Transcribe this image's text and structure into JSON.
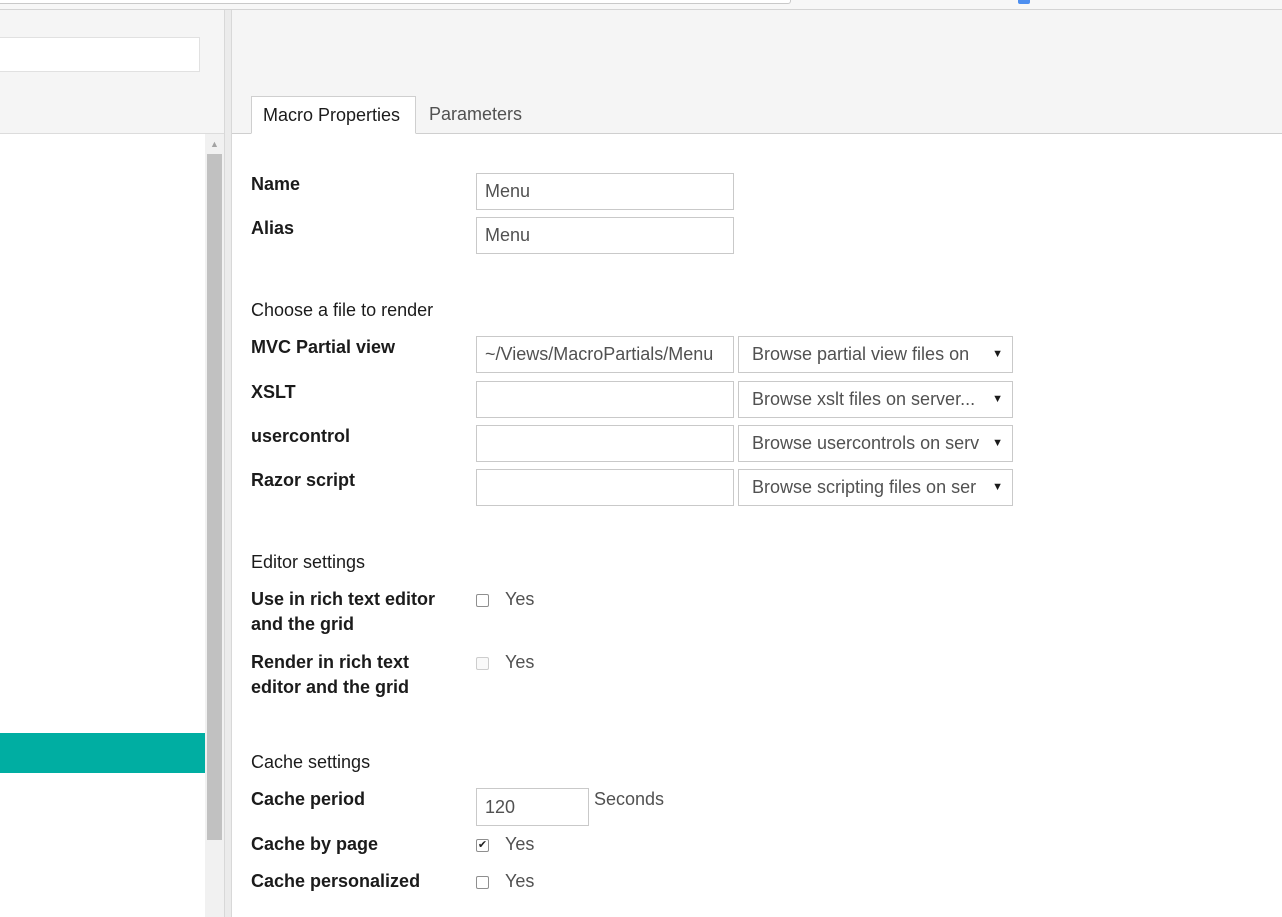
{
  "tabs": [
    {
      "label": "Macro Properties",
      "active": true
    },
    {
      "label": "Parameters",
      "active": false
    }
  ],
  "fields": {
    "name": {
      "label": "Name",
      "value": "Menu"
    },
    "alias": {
      "label": "Alias",
      "value": "Menu"
    }
  },
  "render": {
    "heading": "Choose a file to render",
    "rows": [
      {
        "label": "MVC Partial view",
        "value": "~/Views/MacroPartials/Menu",
        "browse": "Browse partial view files on"
      },
      {
        "label": "XSLT",
        "value": "",
        "browse": "Browse xslt files on server..."
      },
      {
        "label": "usercontrol",
        "value": "",
        "browse": "Browse usercontrols on serv"
      },
      {
        "label": "Razor script",
        "value": "",
        "browse": "Browse scripting files on ser"
      }
    ]
  },
  "editor": {
    "heading": "Editor settings",
    "use_rte_label_1": "Use in rich text editor",
    "use_rte_label_2": "and the grid",
    "use_rte_checked": false,
    "render_rte_label_1": "Render in rich text",
    "render_rte_label_2": "editor and the grid",
    "render_rte_checked": false,
    "yes": "Yes"
  },
  "cache": {
    "heading": "Cache settings",
    "period_label": "Cache period",
    "period_value": "120",
    "period_unit": "Seconds",
    "by_page_label": "Cache by page",
    "by_page_checked": true,
    "personalized_label": "Cache personalized",
    "personalized_checked": false,
    "yes": "Yes"
  },
  "colors": {
    "tree_active": "#00aea2",
    "panel_bg": "#f5f5f5"
  }
}
